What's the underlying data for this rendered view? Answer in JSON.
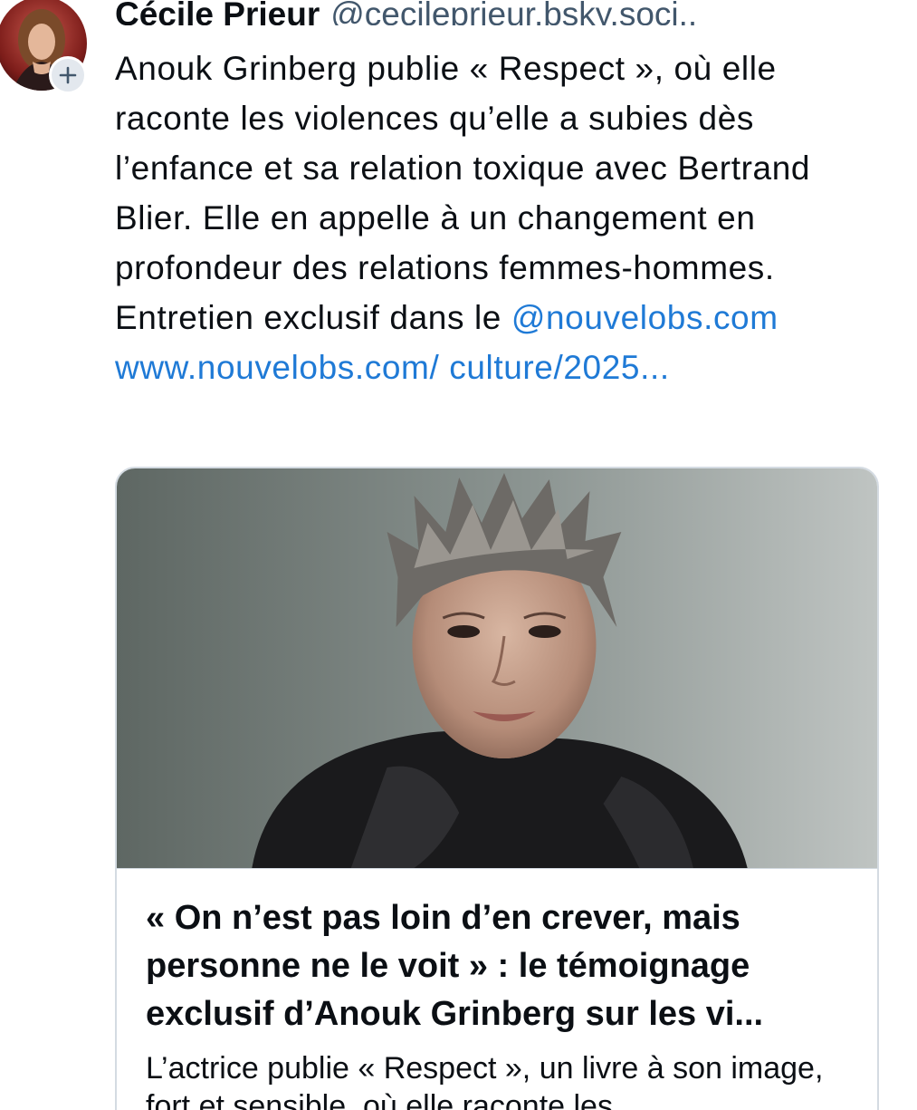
{
  "post": {
    "author_name": "Cécile Prieur",
    "author_handle": "@cecileprieur.bsky.soci..",
    "text_part1": "Anouk Grinberg publie « Respect », où elle raconte les violences qu’elle a subies dès l’enfance et sa relation toxique avec Bertrand Blier. Elle en appelle à un changement en profondeur des relations femmes-hommes. Entretien exclusif dans le ",
    "mention": "@nouvelobs.com",
    "link": "www.nouvelobs.com/ culture/2025...",
    "follow_icon": "plus-icon",
    "avatar_icon": "user-avatar"
  },
  "card": {
    "image_icon": "portrait-photo",
    "title": "« On n’est pas loin d’en crever, mais personne ne le voit » : le témoignage exclusif d’Anouk Grinberg sur les vi...",
    "description": "L’actrice publie « Respect », un livre à son image, fort et sensible, où elle raconte les"
  },
  "colors": {
    "link": "#1f7ad6",
    "handle": "#42576c",
    "text": "#0b0f14",
    "card_border": "#d4dbe2"
  }
}
